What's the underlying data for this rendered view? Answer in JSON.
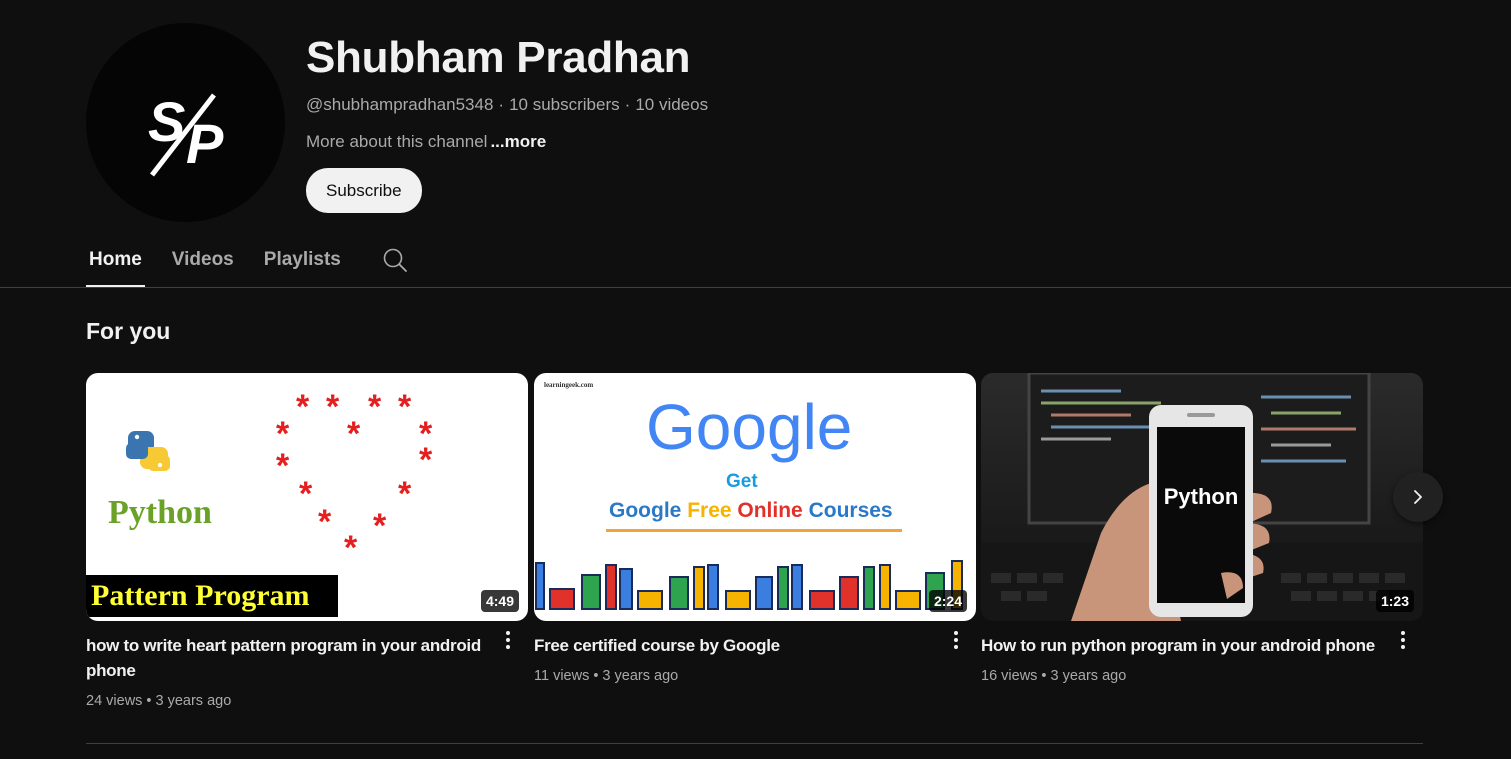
{
  "channel": {
    "name": "Shubham Pradhan",
    "handle": "@shubhampradhan5348",
    "subscribers": "10 subscribers",
    "videos_count": "10 videos",
    "about": "More about this channel",
    "more_label": "...more",
    "subscribe_label": "Subscribe",
    "avatar_text": "SP"
  },
  "tabs": [
    {
      "label": "Home",
      "active": true
    },
    {
      "label": "Videos",
      "active": false
    },
    {
      "label": "Playlists",
      "active": false
    }
  ],
  "section": {
    "title": "For you"
  },
  "videos": [
    {
      "title": "how to write heart pattern program in your android phone",
      "views": "24 views",
      "age": "3 years ago",
      "duration": "4:49",
      "thumb_text": {
        "python": "Python",
        "banner": "Pattern Program"
      }
    },
    {
      "title": "Free certified course by Google",
      "views": "11 views",
      "age": "3 years ago",
      "duration": "2:24",
      "thumb_text": {
        "site": "learningeek.com",
        "logo": "Google",
        "get": "Get",
        "w1": "Google",
        "w2": "Free",
        "w3": "Online",
        "w4": "Courses"
      }
    },
    {
      "title": "How to run python program in your android phone",
      "views": "16 views",
      "age": "3 years ago",
      "duration": "1:23",
      "thumb_text": {
        "phone": "Python"
      }
    }
  ],
  "icons": {
    "search": "search-icon",
    "kebab": "more-vert-icon",
    "next": "chevron-right-icon"
  },
  "colors": {
    "background": "#0f0f0f",
    "text_primary": "#f1f1f1",
    "text_secondary": "#aaaaaa",
    "subscribe_bg": "#f1f1f1"
  }
}
